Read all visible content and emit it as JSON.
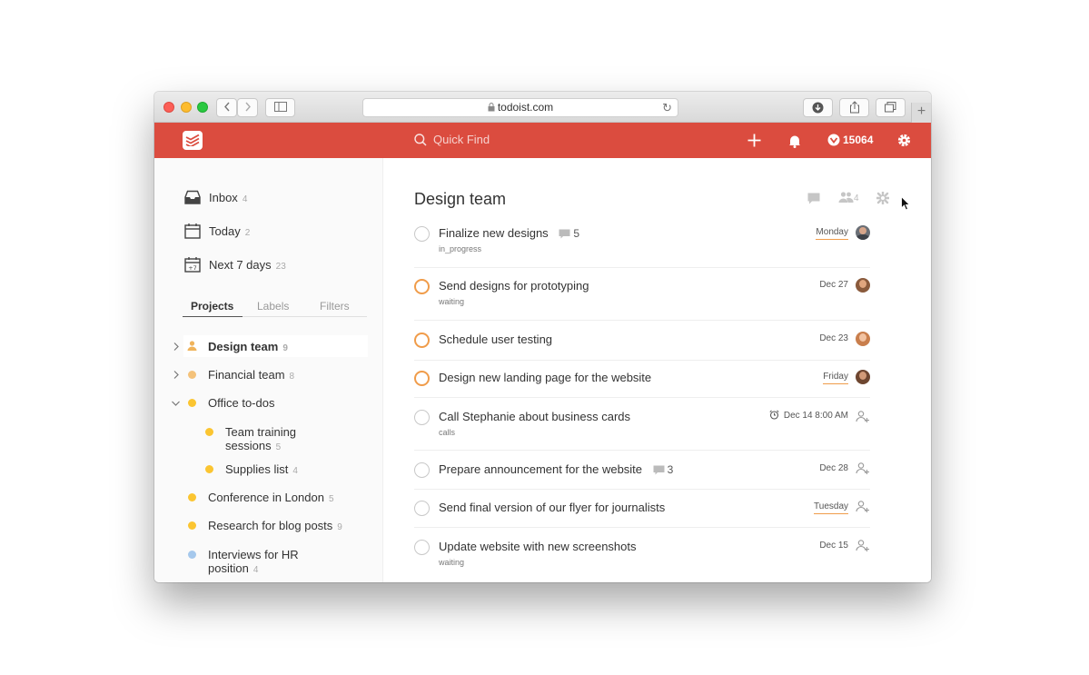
{
  "browser": {
    "url": "todoist.com"
  },
  "header": {
    "quick_find_placeholder": "Quick Find",
    "karma": "15064"
  },
  "sidebar": {
    "nav": [
      {
        "label": "Inbox",
        "count": "4"
      },
      {
        "label": "Today",
        "count": "2"
      },
      {
        "label": "Next 7 days",
        "count": "23"
      }
    ],
    "tabs": [
      {
        "label": "Projects"
      },
      {
        "label": "Labels"
      },
      {
        "label": "Filters"
      }
    ],
    "projects": [
      {
        "label": "Design team",
        "count": "9",
        "color": "#f0b35a"
      },
      {
        "label": "Financial team",
        "count": "8",
        "color": "#f4c27a"
      },
      {
        "label": "Office to-dos",
        "count": "",
        "color": "#fbc531"
      },
      {
        "label": "Team training",
        "label2": "sessions",
        "count": "5",
        "color": "#fbc531"
      },
      {
        "label": "Supplies list",
        "count": "4",
        "color": "#fbc531"
      },
      {
        "label": "Conference in London",
        "count": "5",
        "color": "#fbc531"
      },
      {
        "label": "Research for blog posts",
        "count": "9",
        "color": "#fbc531"
      },
      {
        "label": "Interviews for HR",
        "label2": "position",
        "count": "4",
        "color": "#a5c8ec"
      }
    ]
  },
  "main": {
    "title": "Design team",
    "members_count": "4",
    "tasks": [
      {
        "text": "Finalize new designs",
        "comments": "5",
        "label": "in_progress",
        "date": "Monday"
      },
      {
        "text": "Send designs for prototyping",
        "label": "waiting",
        "date": "Dec 27"
      },
      {
        "text": "Schedule user testing",
        "date": "Dec 23"
      },
      {
        "text": "Design new landing page for the website",
        "date": "Friday"
      },
      {
        "text": "Call Stephanie about business cards",
        "label": "calls",
        "date": "Dec 14 8:00 AM"
      },
      {
        "text": "Prepare announcement for the website",
        "comments": "3",
        "date": "Dec 28"
      },
      {
        "text": "Send final version of our flyer for journalists",
        "date": "Tuesday"
      },
      {
        "text": "Update website with new screenshots",
        "label": "waiting",
        "date": "Dec 15"
      }
    ]
  },
  "colors": {
    "brand": "#db4c3f",
    "priority": "#f09c4a"
  }
}
